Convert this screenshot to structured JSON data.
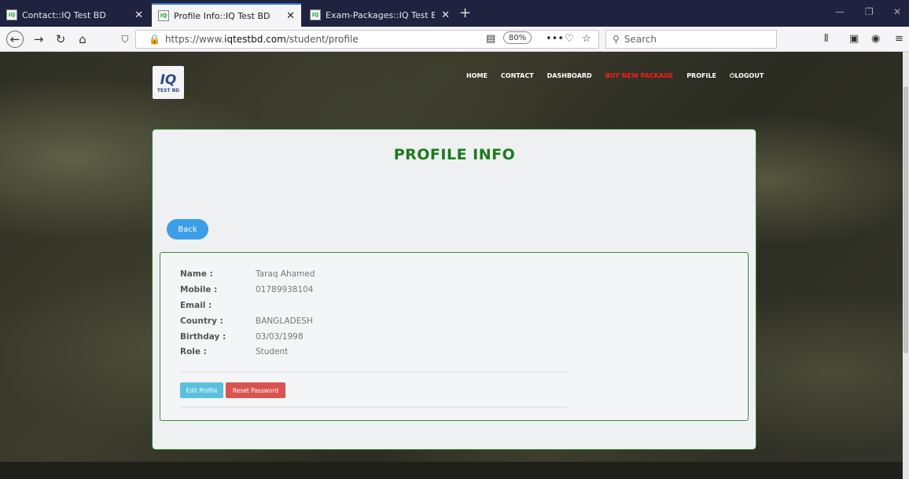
{
  "browser": {
    "tabs": [
      {
        "title": "Contact::IQ Test BD",
        "active": false
      },
      {
        "title": "Profile Info::IQ Test BD",
        "active": true
      },
      {
        "title": "Exam-Packages::IQ Test BD",
        "active": false
      }
    ],
    "url_prefix": "https://www.",
    "url_domain": "iqtestbd.com",
    "url_path": "/student/profile",
    "zoom": "80%",
    "search_placeholder": "Search"
  },
  "site": {
    "logo_text": "IQ",
    "logo_subtext": "TEST BD",
    "nav": [
      "HOME",
      "CONTACT",
      "DASHBOARD",
      "BUY NEW PACKAGE",
      "PROFILE",
      "⏻LOGOUT"
    ],
    "highlight_color": "#ff1a1a"
  },
  "profile": {
    "title": "PROFILE INFO",
    "back_label": "Back",
    "fields": [
      {
        "label": "Name :",
        "value": "Taraq Ahamed"
      },
      {
        "label": "Mobile :",
        "value": "01789938104"
      },
      {
        "label": "Email :",
        "value": ""
      },
      {
        "label": "Country :",
        "value": "BANGLADESH"
      },
      {
        "label": "Birthday :",
        "value": "03/03/1998"
      },
      {
        "label": "Role :",
        "value": "Student"
      }
    ],
    "edit_label": "Edit Profile",
    "reset_label": "Reset Password"
  }
}
